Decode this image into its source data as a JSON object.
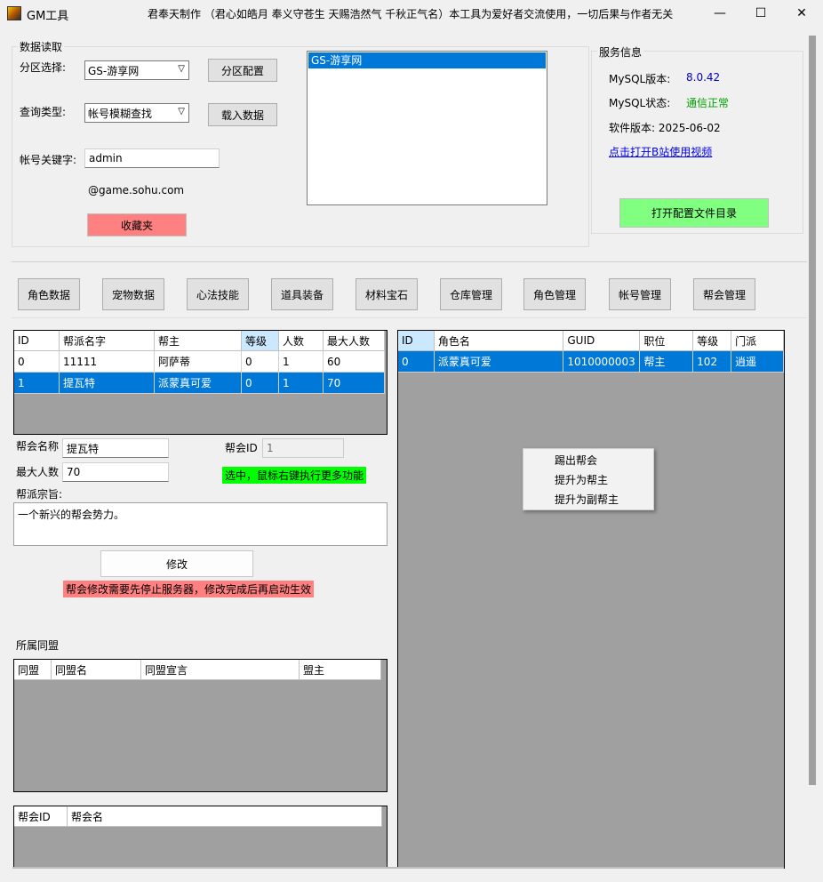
{
  "window": {
    "title": "GM工具",
    "header_message": "君奉天制作 （君心如皓月 奉义守苍生 天赐浩然气 千秋正气名）本工具为爱好者交流使用，一切后果与作者无关",
    "minimize": "—",
    "maximize": "☐",
    "close": "✕"
  },
  "data_read": {
    "legend": "数据读取",
    "zone_label": "分区选择:",
    "zone_value": "GS-游享网",
    "zone_config_btn": "分区配置",
    "query_label": "查询类型:",
    "query_value": "帐号模糊查找",
    "load_btn": "载入数据",
    "keyword_label": "帐号关键字:",
    "keyword_value": "admin",
    "domain_suffix": "@game.sohu.com",
    "favorites_btn": "收藏夹",
    "server_list": [
      "GS-游享网"
    ]
  },
  "service": {
    "legend": "服务信息",
    "mysql_version_label": "MySQL版本:",
    "mysql_version": "8.0.42",
    "mysql_status_label": "MySQL状态:",
    "mysql_status": "通信正常",
    "software_version": "软件版本: 2025-06-02",
    "video_link": "点击打开B站使用视频",
    "open_config_btn": "打开配置文件目录",
    "colors": {
      "version": "#0000cc",
      "status": "#00a000",
      "config_btn": "#80ff80"
    }
  },
  "nav": [
    "角色数据",
    "宠物数据",
    "心法技能",
    "道具装备",
    "材料宝石",
    "仓库管理",
    "角色管理",
    "帐号管理",
    "帮会管理"
  ],
  "guild_table": {
    "headers": [
      "ID",
      "帮派名字",
      "帮主",
      "等级",
      "人数",
      "最大人数"
    ],
    "rows": [
      [
        "0",
        "11111",
        "阿萨蒂",
        "0",
        "1",
        "60"
      ],
      [
        "1",
        "提瓦特",
        "派蒙真可爱",
        "0",
        "1",
        "70"
      ]
    ]
  },
  "guild_form": {
    "name_label": "帮会名称",
    "name_value": "提瓦特",
    "id_label": "帮会ID",
    "id_value": "1",
    "max_label": "最大人数",
    "max_value": "70",
    "hint": "选中，鼠标右键执行更多功能",
    "purpose_label": "帮派宗旨:",
    "purpose_value": "一个新兴的帮会势力。",
    "modify_btn": "修改",
    "warning": "帮会修改需要先停止服务器，修改完成后再启动生效"
  },
  "alliance": {
    "label": "所属同盟",
    "headers": [
      "同盟",
      "同盟名",
      "同盟宣言",
      "盟主"
    ]
  },
  "guild_ref_table": {
    "headers": [
      "帮会ID",
      "帮会名"
    ]
  },
  "member_table": {
    "headers": [
      "ID",
      "角色名",
      "GUID",
      "职位",
      "等级",
      "门派"
    ],
    "rows": [
      [
        "0",
        "派蒙真可爱",
        "1010000003",
        "帮主",
        "102",
        "逍遥"
      ]
    ]
  },
  "context_menu": [
    "踢出帮会",
    "提升为帮主",
    "提升为副帮主"
  ]
}
